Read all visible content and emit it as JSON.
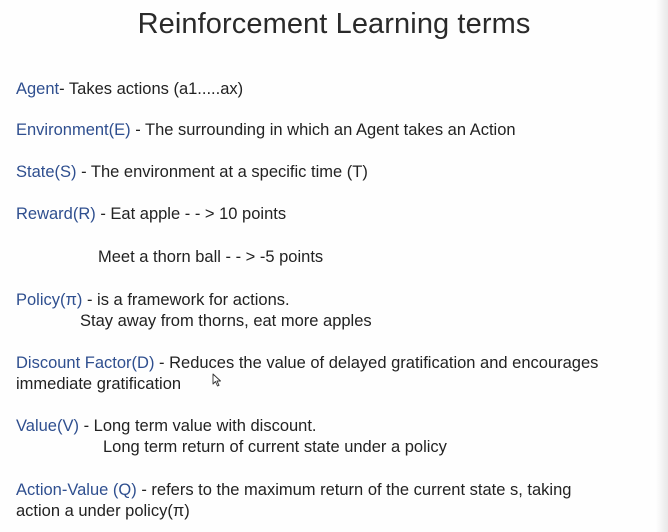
{
  "slide": {
    "title": "Reinforcement Learning terms",
    "agent": {
      "term": "Agent",
      "text": "-  Takes actions (a1.....ax)"
    },
    "environment": {
      "term": "Environment(E)",
      "text": " - The surrounding in which an Agent takes an Action"
    },
    "state": {
      "term": "State(S)",
      "text": " - The environment at a specific time (T)"
    },
    "reward": {
      "term": "Reward(R)",
      "text": " - Eat apple - - > 10 points",
      "line2": "Meet a thorn ball - - > -5 points"
    },
    "policy": {
      "term": "Policy(π)",
      "text": " - is a framework for actions.",
      "line2": "Stay away from thorns, eat more apples"
    },
    "discount": {
      "term": "Discount Factor(D)",
      "text": " - Reduces the value of delayed gratification and encourages",
      "line2": "immediate gratification"
    },
    "value": {
      "term": "Value(V)",
      "text": " - Long term value with discount.",
      "line2": "Long term return of current state under a policy"
    },
    "action_value": {
      "term": "Action-Value (Q)",
      "text": " - refers to the maximum return of the current state s, taking",
      "line2": "action a under policy(π)"
    }
  },
  "colors": {
    "term": "#2f4f8f",
    "text": "#222222"
  }
}
